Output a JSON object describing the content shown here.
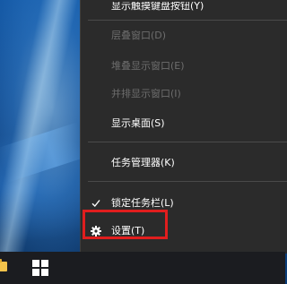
{
  "context_menu": {
    "items": [
      {
        "label": "显示触摸键盘按钮(Y)",
        "state": "partially-visible"
      },
      {
        "label": "层叠窗口(D)",
        "state": "disabled"
      },
      {
        "label": "堆叠显示窗口(E)",
        "state": "disabled"
      },
      {
        "label": "并排显示窗口(I)",
        "state": "disabled"
      },
      {
        "label": "显示桌面(S)",
        "state": "enabled"
      },
      {
        "label": "任务管理器(K)",
        "state": "enabled"
      },
      {
        "label": "锁定任务栏(L)",
        "state": "checked",
        "icon": "check-icon"
      },
      {
        "label": "设置(T)",
        "state": "enabled",
        "icon": "gear-icon"
      }
    ]
  },
  "taskbar": {
    "icons": [
      "file-explorer-icon",
      "windows-start-icon"
    ]
  },
  "colors": {
    "menu_background": "#2b2b2b",
    "menu_text": "#ffffff",
    "menu_disabled_text": "#6d6d6d",
    "highlight": "#e01e1e",
    "taskbar": "#1b1c20"
  }
}
